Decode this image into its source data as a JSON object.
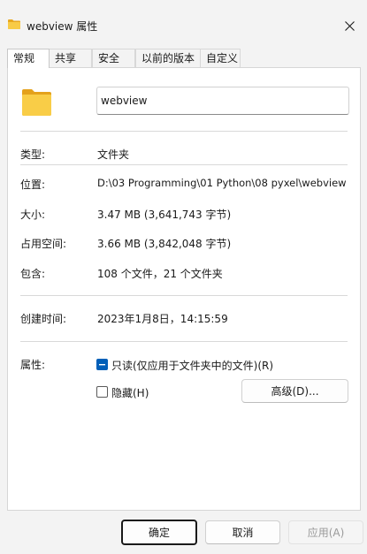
{
  "window": {
    "title": "webview 属性"
  },
  "tabs": [
    {
      "label": "常规"
    },
    {
      "label": "共享"
    },
    {
      "label": "安全"
    },
    {
      "label": "以前的版本"
    },
    {
      "label": "自定义"
    }
  ],
  "name_field": {
    "value": "webview"
  },
  "properties": {
    "type": {
      "label": "类型:",
      "value": "文件夹"
    },
    "location": {
      "label": "位置:",
      "value": "D:\\03 Programming\\01 Python\\08 pyxel\\webview"
    },
    "size": {
      "label": "大小:",
      "value": "3.47 MB (3,641,743 字节)"
    },
    "size_on_disk": {
      "label": "占用空间:",
      "value": "3.66 MB (3,842,048 字节)"
    },
    "contains": {
      "label": "包含:",
      "value": "108 个文件，21 个文件夹"
    },
    "created": {
      "label": "创建时间:",
      "value": "2023年1月8日，14:15:59"
    },
    "attributes_label": "属性:"
  },
  "attributes": {
    "readonly": {
      "label": "只读(仅应用于文件夹中的文件)(R)",
      "checked": true
    },
    "hidden": {
      "label": "隐藏(H)",
      "checked": false
    },
    "advanced_button": "高级(D)..."
  },
  "buttons": {
    "ok": "确定",
    "cancel": "取消",
    "apply": "应用(A)"
  },
  "colors": {
    "folder": "#f4c430",
    "accent": "#005fb8"
  }
}
